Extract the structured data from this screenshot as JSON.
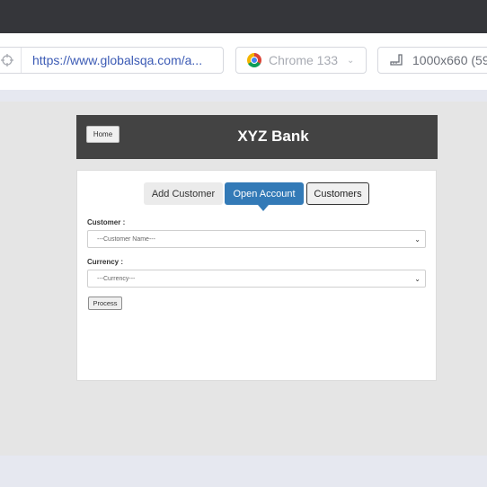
{
  "browser": {
    "url": "https://www.globalsqa.com/a...",
    "browser_name": "Chrome 133",
    "resolution": "1000x660 (59%)"
  },
  "app": {
    "home_button": "Home",
    "title": "XYZ Bank"
  },
  "tabs": [
    {
      "label": "Add Customer"
    },
    {
      "label": "Open Account",
      "active": true
    },
    {
      "label": "Customers"
    }
  ],
  "form": {
    "customer_label": "Customer :",
    "customer_select": "---Customer Name---",
    "currency_label": "Currency :",
    "currency_select": "---Currency---",
    "process_button": "Process"
  },
  "colors": {
    "active_tab": "#337ab7",
    "header_bg": "#434343"
  },
  "icons": [
    "crosshair-icon",
    "chrome-logo-icon",
    "chevron-down-icon",
    "ruler-icon"
  ]
}
